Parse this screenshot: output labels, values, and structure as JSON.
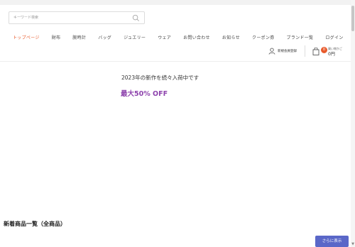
{
  "search": {
    "placeholder": "キーワード検索"
  },
  "nav": {
    "items": [
      {
        "label": "トップページ",
        "active": true
      },
      {
        "label": "財布"
      },
      {
        "label": "腕時計"
      },
      {
        "label": "バッグ"
      },
      {
        "label": "ジュエリー"
      },
      {
        "label": "ウェア"
      },
      {
        "label": "お問い合わせ"
      },
      {
        "label": "お知らせ"
      },
      {
        "label": "クーポン券"
      },
      {
        "label": "ブランド一覧"
      },
      {
        "label": "ログイン"
      }
    ]
  },
  "account": {
    "register_label": "新規会員登録"
  },
  "cart": {
    "count": "0",
    "subtitle": "買い物かご",
    "total": "0円"
  },
  "promo": {
    "headline": "2023年の新作を続々入荷中です",
    "sale": "最大50% OFF"
  },
  "section": {
    "title": "新着商品一覧（全商品）"
  },
  "more_button": {
    "label": "さらに表示"
  },
  "colors": {
    "accent": "#e85a2c",
    "sale": "#8e44ad",
    "button": "#5a67c8"
  }
}
